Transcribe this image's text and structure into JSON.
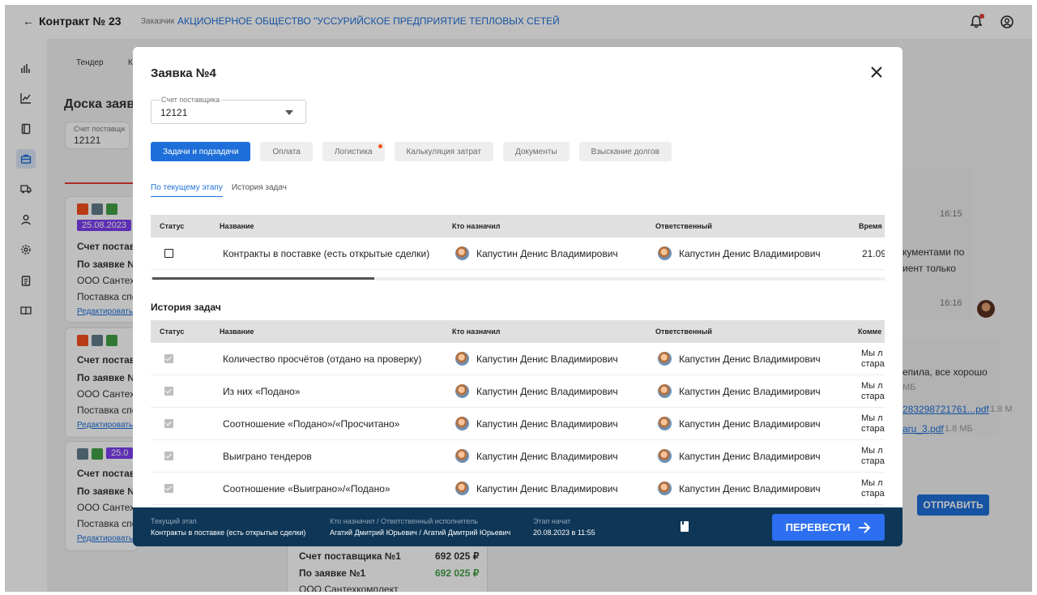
{
  "topbar": {
    "title": "Контракт № 23",
    "customer_label": "Заказчик",
    "customer": "АКЦИОНЕРНОЕ ОБЩЕСТВО \"УССУРИЙСКОЕ ПРЕДПРИЯТИЕ ТЕПЛОВЫХ СЕТЕЙ"
  },
  "background": {
    "tab_label": "Тендер",
    "tab_cut": "К",
    "board_title": "Доска заяво",
    "account_label": "Счет поставщи",
    "account_value": "12121",
    "date_badge": "25.08.2023",
    "date_badge_cut": "25.0",
    "card_line1": "Счет постави",
    "card_line2": "По заявке №",
    "card_line3": "ООО Сантехк",
    "card_line4": "Поставка спе",
    "edit_link": "Редактировать",
    "chat_time1": "16:15",
    "chat_text1": "кументами по",
    "chat_text2": "иент только",
    "chat_time2": "16:16",
    "chat_text3": "епила, все хорошо",
    "chat_size": "МБ",
    "chat_file1": "283298721761...pdf",
    "chat_file1_size": "1.8 М",
    "chat_file2": "aru_3.pdf",
    "chat_file2_size": "1.8 МБ",
    "send_button": "ОТПРАВИТЬ",
    "bottom_card_l1": "Счет поставщика №1",
    "bottom_card_v1": "692 025 ₽",
    "bottom_card_l2": "По заявке №1",
    "bottom_card_v2": "692 025 ₽",
    "bottom_card_l3": "ООО Сантехкомплект"
  },
  "modal": {
    "title": "Заявка №4",
    "supplier_select": {
      "label": "Счет поставщика",
      "value": "12121"
    },
    "tabs": [
      {
        "label": "Задачи и подзадачи"
      },
      {
        "label": "Оплата"
      },
      {
        "label": "Логистика"
      },
      {
        "label": "Калькуляция затрат"
      },
      {
        "label": "Документы"
      },
      {
        "label": "Взыскание долгов"
      }
    ],
    "subtabs": [
      {
        "label": "По текущему этапу"
      },
      {
        "label": "История задач"
      }
    ],
    "current_table": {
      "columns": [
        "Статус",
        "Название",
        "Кто назначил",
        "Ответственный",
        "Время"
      ],
      "rows": [
        {
          "name": "Контракты в поставке (есть открытые сделки)",
          "assigner": "Капустин Денис Владимирович",
          "responsible": "Капустин Денис Владимирович",
          "time": "21.09"
        }
      ]
    },
    "history_title": "История задач",
    "history_table": {
      "columns": [
        "Статус",
        "Название",
        "Кто назначил",
        "Ответственный",
        "Комме"
      ],
      "rows": [
        {
          "name": "Количество просчётов (отдано на проверку)",
          "assigner": "Капустин Денис Владимирович",
          "responsible": "Капустин Денис Владимирович",
          "comment1": "Мы л",
          "comment2": "стара"
        },
        {
          "name": "Из них «Подано»",
          "assigner": "Капустин Денис Владимирович",
          "responsible": "Капустин Денис Владимирович",
          "comment1": "Мы л",
          "comment2": "стара"
        },
        {
          "name": "Соотношение «Подано»/«Просчитано»",
          "assigner": "Капустин Денис Владимирович",
          "responsible": "Капустин Денис Владимирович",
          "comment1": "Мы л",
          "comment2": "стара"
        },
        {
          "name": "Выиграно тендеров",
          "assigner": "Капустин Денис Владимирович",
          "responsible": "Капустин Денис Владимирович",
          "comment1": "Мы л",
          "comment2": "стара"
        },
        {
          "name": "Соотношение «Выиграно»/«Подано»",
          "assigner": "Капустин Денис Владимирович",
          "responsible": "Капустин Денис Владимирович",
          "comment1": "Мы л",
          "comment2": "стара"
        }
      ]
    },
    "footer": {
      "stage_label": "Текущий этап",
      "stage_value": "Контракты в поставке (есть открытые сделки)",
      "assignee_label": "Кто назначил / Ответственный исполнитель",
      "assignee_value": "Агатий Дмитрий Юрьевич / Агатий Дмитрий Юрьевич",
      "started_label": "Этап начат",
      "started_value": "20.08.2023 в 11:55",
      "transfer_button": "ПЕРЕВЕСТИ"
    }
  }
}
